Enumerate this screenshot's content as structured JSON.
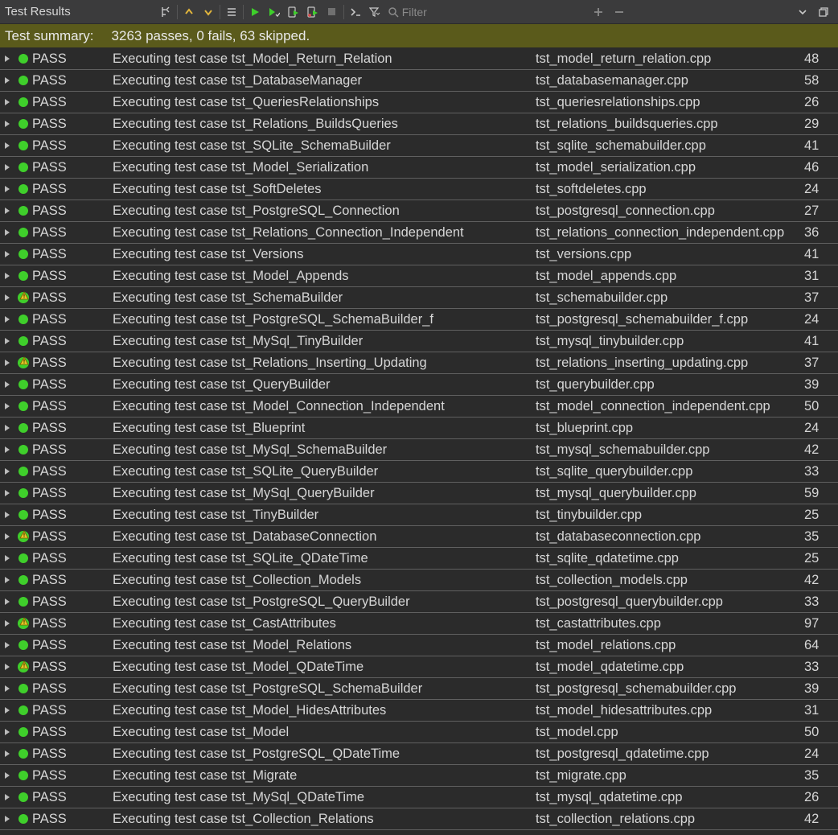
{
  "toolbar": {
    "title": "Test Results",
    "filter_placeholder": "Filter"
  },
  "summary": {
    "label": "Test summary:",
    "value": "3263 passes, 0 fails, 63 skipped."
  },
  "rows": [
    {
      "icon": "pass",
      "status": "PASS",
      "desc": "Executing test case tst_Model_Return_Relation",
      "file": "tst_model_return_relation.cpp",
      "count": "48"
    },
    {
      "icon": "pass",
      "status": "PASS",
      "desc": "Executing test case tst_DatabaseManager",
      "file": "tst_databasemanager.cpp",
      "count": "58"
    },
    {
      "icon": "pass",
      "status": "PASS",
      "desc": "Executing test case tst_QueriesRelationships",
      "file": "tst_queriesrelationships.cpp",
      "count": "26"
    },
    {
      "icon": "pass",
      "status": "PASS",
      "desc": "Executing test case tst_Relations_BuildsQueries",
      "file": "tst_relations_buildsqueries.cpp",
      "count": "29"
    },
    {
      "icon": "pass",
      "status": "PASS",
      "desc": "Executing test case tst_SQLite_SchemaBuilder",
      "file": "tst_sqlite_schemabuilder.cpp",
      "count": "41"
    },
    {
      "icon": "pass",
      "status": "PASS",
      "desc": "Executing test case tst_Model_Serialization",
      "file": "tst_model_serialization.cpp",
      "count": "46"
    },
    {
      "icon": "pass",
      "status": "PASS",
      "desc": "Executing test case tst_SoftDeletes",
      "file": "tst_softdeletes.cpp",
      "count": "24"
    },
    {
      "icon": "pass",
      "status": "PASS",
      "desc": "Executing test case tst_PostgreSQL_Connection",
      "file": "tst_postgresql_connection.cpp",
      "count": "27"
    },
    {
      "icon": "pass",
      "status": "PASS",
      "desc": "Executing test case tst_Relations_Connection_Independent",
      "file": "tst_relations_connection_independent.cpp",
      "count": "36"
    },
    {
      "icon": "pass",
      "status": "PASS",
      "desc": "Executing test case tst_Versions",
      "file": "tst_versions.cpp",
      "count": "41"
    },
    {
      "icon": "pass",
      "status": "PASS",
      "desc": "Executing test case tst_Model_Appends",
      "file": "tst_model_appends.cpp",
      "count": "31"
    },
    {
      "icon": "warn",
      "status": "PASS",
      "desc": "Executing test case tst_SchemaBuilder",
      "file": "tst_schemabuilder.cpp",
      "count": "37"
    },
    {
      "icon": "pass",
      "status": "PASS",
      "desc": "Executing test case tst_PostgreSQL_SchemaBuilder_f",
      "file": "tst_postgresql_schemabuilder_f.cpp",
      "count": "24"
    },
    {
      "icon": "pass",
      "status": "PASS",
      "desc": "Executing test case tst_MySql_TinyBuilder",
      "file": "tst_mysql_tinybuilder.cpp",
      "count": "41"
    },
    {
      "icon": "warn",
      "status": "PASS",
      "desc": "Executing test case tst_Relations_Inserting_Updating",
      "file": "tst_relations_inserting_updating.cpp",
      "count": "37"
    },
    {
      "icon": "pass",
      "status": "PASS",
      "desc": "Executing test case tst_QueryBuilder",
      "file": "tst_querybuilder.cpp",
      "count": "39"
    },
    {
      "icon": "pass",
      "status": "PASS",
      "desc": "Executing test case tst_Model_Connection_Independent",
      "file": "tst_model_connection_independent.cpp",
      "count": "50"
    },
    {
      "icon": "pass",
      "status": "PASS",
      "desc": "Executing test case tst_Blueprint",
      "file": "tst_blueprint.cpp",
      "count": "24"
    },
    {
      "icon": "pass",
      "status": "PASS",
      "desc": "Executing test case tst_MySql_SchemaBuilder",
      "file": "tst_mysql_schemabuilder.cpp",
      "count": "42"
    },
    {
      "icon": "pass",
      "status": "PASS",
      "desc": "Executing test case tst_SQLite_QueryBuilder",
      "file": "tst_sqlite_querybuilder.cpp",
      "count": "33"
    },
    {
      "icon": "pass",
      "status": "PASS",
      "desc": "Executing test case tst_MySql_QueryBuilder",
      "file": "tst_mysql_querybuilder.cpp",
      "count": "59"
    },
    {
      "icon": "pass",
      "status": "PASS",
      "desc": "Executing test case tst_TinyBuilder",
      "file": "tst_tinybuilder.cpp",
      "count": "25"
    },
    {
      "icon": "warn",
      "status": "PASS",
      "desc": "Executing test case tst_DatabaseConnection",
      "file": "tst_databaseconnection.cpp",
      "count": "35"
    },
    {
      "icon": "pass",
      "status": "PASS",
      "desc": "Executing test case tst_SQLite_QDateTime",
      "file": "tst_sqlite_qdatetime.cpp",
      "count": "25"
    },
    {
      "icon": "pass",
      "status": "PASS",
      "desc": "Executing test case tst_Collection_Models",
      "file": "tst_collection_models.cpp",
      "count": "42"
    },
    {
      "icon": "pass",
      "status": "PASS",
      "desc": "Executing test case tst_PostgreSQL_QueryBuilder",
      "file": "tst_postgresql_querybuilder.cpp",
      "count": "33"
    },
    {
      "icon": "warn",
      "status": "PASS",
      "desc": "Executing test case tst_CastAttributes",
      "file": "tst_castattributes.cpp",
      "count": "97"
    },
    {
      "icon": "pass",
      "status": "PASS",
      "desc": "Executing test case tst_Model_Relations",
      "file": "tst_model_relations.cpp",
      "count": "64"
    },
    {
      "icon": "warn",
      "status": "PASS",
      "desc": "Executing test case tst_Model_QDateTime",
      "file": "tst_model_qdatetime.cpp",
      "count": "33"
    },
    {
      "icon": "pass",
      "status": "PASS",
      "desc": "Executing test case tst_PostgreSQL_SchemaBuilder",
      "file": "tst_postgresql_schemabuilder.cpp",
      "count": "39"
    },
    {
      "icon": "pass",
      "status": "PASS",
      "desc": "Executing test case tst_Model_HidesAttributes",
      "file": "tst_model_hidesattributes.cpp",
      "count": "31"
    },
    {
      "icon": "pass",
      "status": "PASS",
      "desc": "Executing test case tst_Model",
      "file": "tst_model.cpp",
      "count": "50"
    },
    {
      "icon": "pass",
      "status": "PASS",
      "desc": "Executing test case tst_PostgreSQL_QDateTime",
      "file": "tst_postgresql_qdatetime.cpp",
      "count": "24"
    },
    {
      "icon": "pass",
      "status": "PASS",
      "desc": "Executing test case tst_Migrate",
      "file": "tst_migrate.cpp",
      "count": "35"
    },
    {
      "icon": "pass",
      "status": "PASS",
      "desc": "Executing test case tst_MySql_QDateTime",
      "file": "tst_mysql_qdatetime.cpp",
      "count": "26"
    },
    {
      "icon": "pass",
      "status": "PASS",
      "desc": "Executing test case tst_Collection_Relations",
      "file": "tst_collection_relations.cpp",
      "count": "42"
    }
  ]
}
